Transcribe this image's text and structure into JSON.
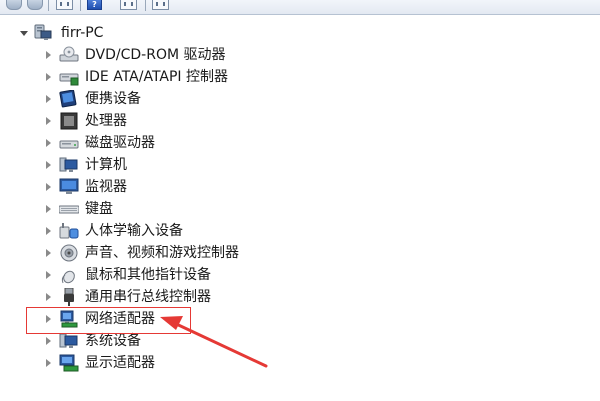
{
  "toolbar": {
    "buttons": [
      "back-arrow-icon",
      "forward-arrow-icon",
      "properties-icon",
      "help-icon",
      "panel-icon",
      "scan-icon"
    ]
  },
  "tree": {
    "root": {
      "label": "firr-PC",
      "icon": "computer-icon"
    },
    "items": [
      {
        "label": "DVD/CD-ROM 驱动器",
        "icon": "dvd-drive-icon"
      },
      {
        "label": "IDE ATA/ATAPI 控制器",
        "icon": "ide-controller-icon"
      },
      {
        "label": "便携设备",
        "icon": "portable-device-icon"
      },
      {
        "label": "处理器",
        "icon": "processor-icon"
      },
      {
        "label": "磁盘驱动器",
        "icon": "disk-drive-icon"
      },
      {
        "label": "计算机",
        "icon": "computer-icon"
      },
      {
        "label": "监视器",
        "icon": "monitor-icon"
      },
      {
        "label": "键盘",
        "icon": "keyboard-icon"
      },
      {
        "label": "人体学输入设备",
        "icon": "hid-icon"
      },
      {
        "label": "声音、视频和游戏控制器",
        "icon": "sound-icon"
      },
      {
        "label": "鼠标和其他指针设备",
        "icon": "mouse-icon"
      },
      {
        "label": "通用串行总线控制器",
        "icon": "usb-icon"
      },
      {
        "label": "网络适配器",
        "icon": "network-adapter-icon"
      },
      {
        "label": "系统设备",
        "icon": "system-device-icon"
      },
      {
        "label": "显示适配器",
        "icon": "display-adapter-icon"
      }
    ]
  },
  "annotation": {
    "highlighted_item": "网络适配器",
    "color": "#e53935"
  }
}
